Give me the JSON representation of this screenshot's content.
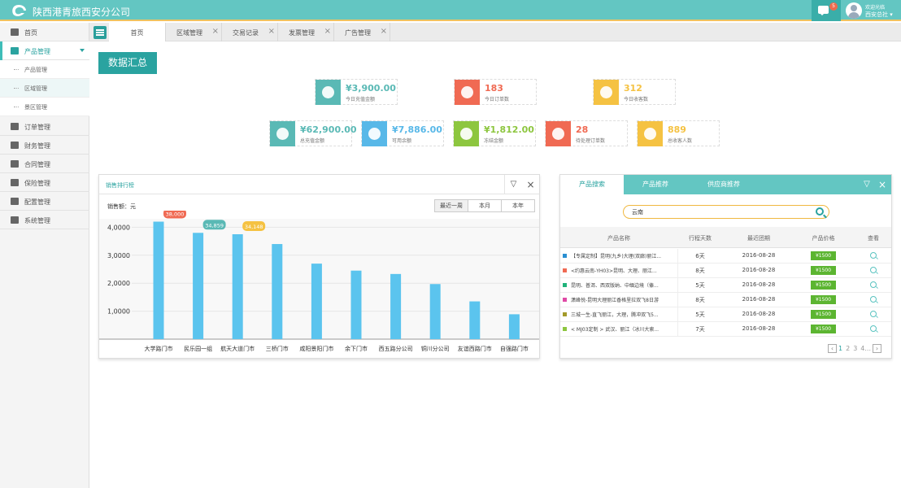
{
  "header": {
    "title": "陕西港青旅西安分公司",
    "welcome": "欢迎光临",
    "user": "西安总社 ▾",
    "msg_count": "5"
  },
  "sidebar": {
    "items": [
      {
        "label": "首页"
      },
      {
        "label": "产品管理"
      },
      {
        "label": "订单管理"
      },
      {
        "label": "财务管理"
      },
      {
        "label": "合同管理"
      },
      {
        "label": "保险管理"
      },
      {
        "label": "配置管理"
      },
      {
        "label": "系统管理"
      }
    ],
    "subitems": [
      {
        "label": "产品管理"
      },
      {
        "label": "区域管理"
      },
      {
        "label": "景区管理"
      }
    ]
  },
  "tabs": [
    {
      "label": "首页"
    },
    {
      "label": "区域管理"
    },
    {
      "label": "交易记录"
    },
    {
      "label": "发票管理"
    },
    {
      "label": "广告管理"
    }
  ],
  "summary_button": "数据汇总",
  "stats": [
    {
      "value": "¥3,900.00",
      "label": "今日充值金额",
      "color": "#5ab9b5"
    },
    {
      "value": "183",
      "label": "今日订单数",
      "color": "#f06a53"
    },
    {
      "value": "312",
      "label": "今日收客数",
      "color": "#f5c242"
    },
    {
      "value": "¥62,900.00",
      "label": "总充值金额",
      "color": "#5ab9b5"
    },
    {
      "value": "¥7,886.00",
      "label": "可用余额",
      "color": "#58b8e8"
    },
    {
      "value": "¥1,812.00",
      "label": "冻结金额",
      "color": "#8dc63f"
    },
    {
      "value": "28",
      "label": "待处理订单数",
      "color": "#f06a53"
    },
    {
      "value": "889",
      "label": "总收客人数",
      "color": "#f5c242"
    }
  ],
  "chart_panel": {
    "title": "销售排行榜",
    "unit": "销售额：元",
    "ranges": [
      "最近一周",
      "本月",
      "本年"
    ]
  },
  "chart_data": {
    "type": "bar",
    "categories": [
      "大学路门市",
      "民乐园一组",
      "航天大道门市",
      "三桥门市",
      "咸阳景阳门市",
      "余下门市",
      "西五路分公司",
      "铜川分公司",
      "友谊西路门市",
      "自强路门市"
    ],
    "values": [
      4200,
      3800,
      3750,
      3400,
      2700,
      2450,
      2330,
      1970,
      1350,
      890
    ],
    "ylim": [
      0,
      4000
    ],
    "yticks": [
      "1,0000",
      "2,0000",
      "3,0000",
      "4,0000"
    ],
    "callouts": [
      {
        "text": "38,000",
        "color": "#f06a53",
        "index": 0
      },
      {
        "text": "34,859",
        "color": "#5ab9b5",
        "index": 1
      },
      {
        "text": "34,148",
        "color": "#f5c242",
        "index": 2
      }
    ],
    "bar_color": "#5bc4ee"
  },
  "product_panel": {
    "tabs": [
      "产品搜索",
      "产品推荐",
      "供应商推荐"
    ],
    "search_value": "云南",
    "columns": [
      "产品名称",
      "行程天数",
      "最近团期",
      "产品价格",
      "查看"
    ],
    "rows": [
      {
        "name": "【专属定制】昆明(九乡)大理(双廊)丽江...",
        "days": "6天",
        "date": "2016-08-28",
        "price": "¥1500",
        "color": "#2a8fd1"
      },
      {
        "name": "<约惠云南-YH03>昆明、大理、丽江...",
        "days": "8天",
        "date": "2016-08-28",
        "price": "¥1500",
        "color": "#f06a53"
      },
      {
        "name": "昆明、普洱、西双版纳、中缅边境（傣...",
        "days": "5天",
        "date": "2016-08-28",
        "price": "¥1500",
        "color": "#20b27a"
      },
      {
        "name": "潇峰悦-昆明大理丽江香格里拉双飞8日游",
        "days": "8天",
        "date": "2016-08-28",
        "price": "¥1500",
        "color": "#e04aa6"
      },
      {
        "name": "三城一生-直飞丽江，大理，腾冲双飞5...",
        "days": "5天",
        "date": "2016-08-28",
        "price": "¥1500",
        "color": "#a39a2a"
      },
      {
        "name": "< MJ03定制 > 武汉、丽江（冰川大索...",
        "days": "7天",
        "date": "2016-08-28",
        "price": "¥1500",
        "color": "#8dc63f"
      }
    ],
    "pager": [
      "1",
      "2",
      "3",
      "4..."
    ]
  }
}
